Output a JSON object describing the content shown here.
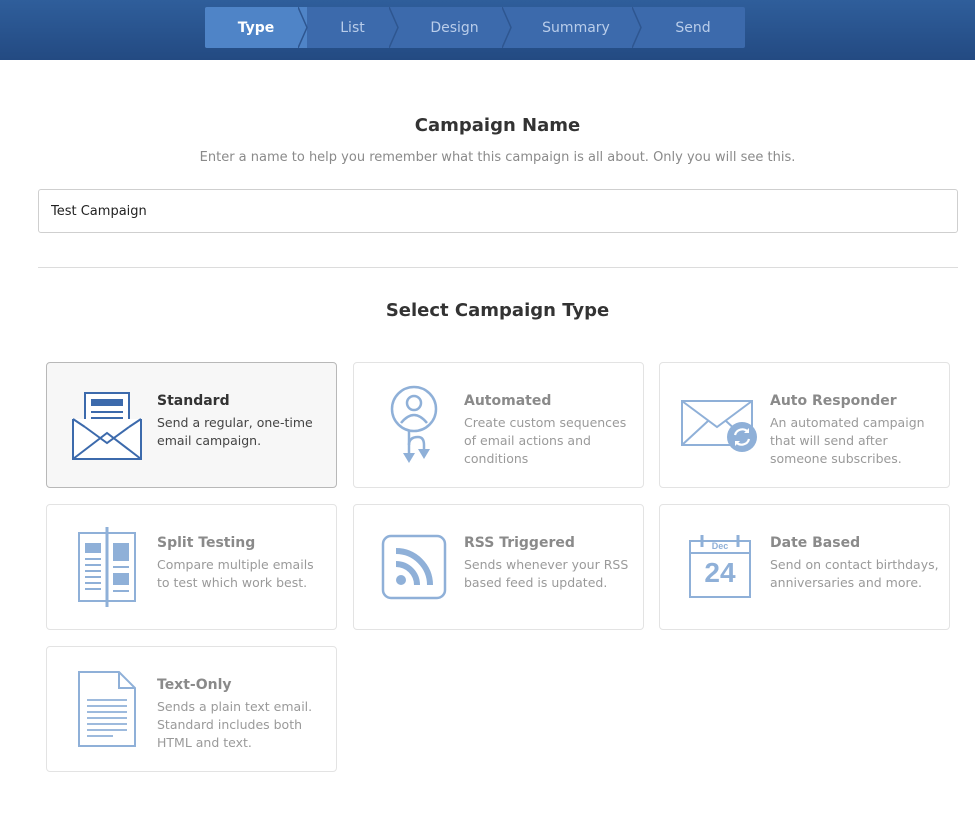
{
  "steps": [
    {
      "label": "Type",
      "active": true
    },
    {
      "label": "List",
      "active": false
    },
    {
      "label": "Design",
      "active": false
    },
    {
      "label": "Summary",
      "active": false
    },
    {
      "label": "Send",
      "active": false
    }
  ],
  "campaign_name": {
    "title": "Campaign Name",
    "subtitle": "Enter a name to help you remember what this campaign is all about. Only you will see this.",
    "value": "Test Campaign"
  },
  "campaign_type": {
    "title": "Select Campaign Type",
    "cards": [
      {
        "title": "Standard",
        "desc": "Send a regular, one-time email campaign.",
        "icon": "envelope-newsletter-icon",
        "selected": true
      },
      {
        "title": "Automated",
        "desc": "Create custom sequences of email actions and conditions",
        "icon": "person-branch-icon",
        "selected": false
      },
      {
        "title": "Auto Responder",
        "desc": "An automated campaign that will send after someone subscribes.",
        "icon": "envelope-refresh-icon",
        "selected": false
      },
      {
        "title": "Split Testing",
        "desc": "Compare multiple emails to test which work best.",
        "icon": "split-document-icon",
        "selected": false
      },
      {
        "title": "RSS Triggered",
        "desc": "Sends whenever your RSS based feed is updated.",
        "icon": "rss-icon",
        "selected": false
      },
      {
        "title": "Date Based",
        "desc": "Send on contact birthdays, anniversaries and more.",
        "icon": "calendar-icon",
        "selected": false
      },
      {
        "title": "Text-Only",
        "desc": "Sends a plain text email. Standard includes both HTML and text.",
        "icon": "text-document-icon",
        "selected": false
      }
    ]
  },
  "calendar_icon": {
    "month": "Dec",
    "day": "24"
  },
  "colors": {
    "accent": "#4f84c7",
    "icon": "#8fb0d8",
    "icon_active": "#3c6aac"
  }
}
